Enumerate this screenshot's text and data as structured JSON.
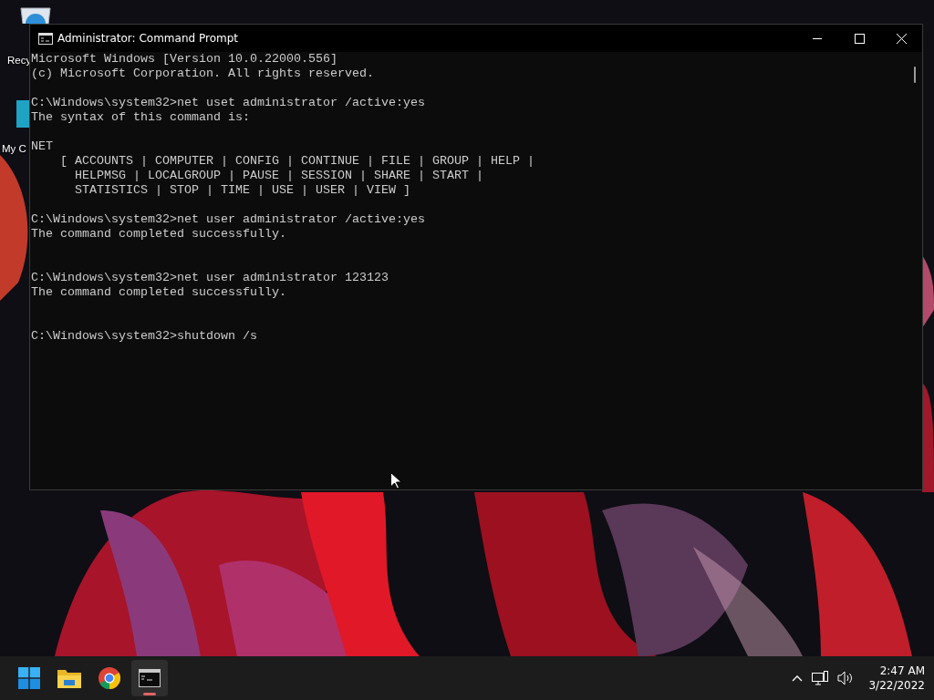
{
  "desktop": {
    "icons": [
      {
        "kind": "bin",
        "label": "Recy"
      },
      {
        "kind": "computer",
        "label": "My C"
      }
    ]
  },
  "window": {
    "title": "Administrator: Command Prompt",
    "console": {
      "blocks": [
        {
          "kind": "block",
          "lines": [
            "Microsoft Windows [Version 10.0.22000.556]",
            "(c) Microsoft Corporation. All rights reserved."
          ]
        },
        {
          "kind": "block",
          "lines": [
            "C:\\Windows\\system32>net uset administrator /active:yes",
            "The syntax of this command is:"
          ]
        },
        {
          "kind": "block",
          "lines": [
            "NET",
            "    [ ACCOUNTS | COMPUTER | CONFIG | CONTINUE | FILE | GROUP | HELP |",
            "      HELPMSG | LOCALGROUP | PAUSE | SESSION | SHARE | START |",
            "      STATISTICS | STOP | TIME | USE | USER | VIEW ]"
          ]
        },
        {
          "kind": "spaced",
          "lines": [
            "C:\\Windows\\system32>net user administrator /active:yes",
            "The command completed successfully."
          ]
        },
        {
          "kind": "spaced",
          "lines": [
            "C:\\Windows\\system32>net user administrator 123123",
            "The command completed successfully."
          ]
        },
        {
          "kind": "block",
          "lines": [
            "C:\\Windows\\system32>shutdown /s"
          ]
        }
      ]
    }
  },
  "taskbar": {
    "apps": [
      {
        "kind": "start",
        "selected": false
      },
      {
        "kind": "folder",
        "selected": false
      },
      {
        "kind": "browser",
        "selected": false
      },
      {
        "kind": "terminal",
        "selected": true
      }
    ],
    "clock": {
      "time": "2:47 AM",
      "date": "3/22/2022"
    }
  }
}
